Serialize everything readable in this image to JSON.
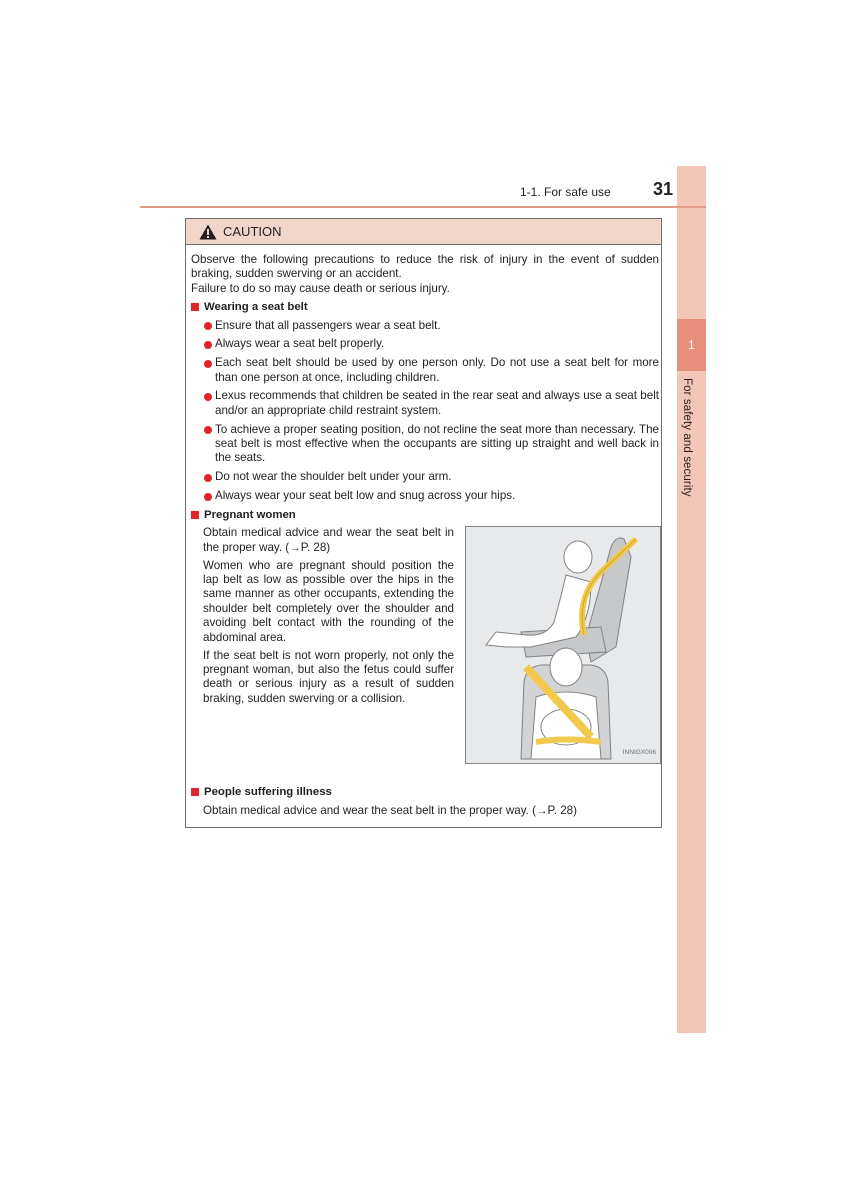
{
  "header": {
    "section": "1-1. For safe use",
    "page_number": "31"
  },
  "side_tab": {
    "chapter_number": "1",
    "chapter_title": "For safety and security"
  },
  "caution": {
    "icon": "warning-triangle-icon",
    "title": "CAUTION",
    "intro": [
      "Observe the following precautions to reduce the risk of injury in the event of sudden braking, sudden swerving or an accident.",
      "Failure to do so may cause death or serious injury."
    ],
    "sections": [
      {
        "heading": "Wearing a seat belt",
        "bullets": [
          "Ensure that all passengers wear a seat belt.",
          "Always wear a seat belt properly.",
          "Each seat belt should be used by one person only. Do not use a seat belt for more than one person at once, including children.",
          "Lexus recommends that children be seated in the rear seat and always use a seat belt and/or an appropriate child restraint system.",
          "To achieve a proper seating position, do not recline the seat more than necessary. The seat belt is most effective when the occupants are sitting up straight and well back in the seats.",
          "Do not wear the shoulder belt under your arm.",
          "Always wear your seat belt low and snug across your hips."
        ]
      },
      {
        "heading": "Pregnant women",
        "paragraphs": [
          "Obtain medical advice and wear the seat belt in the proper way. (→P. 28)",
          "Women who are pregnant should position the lap belt as low as possible over the hips in the same manner as other occupants, extending the shoulder belt completely over the shoulder and avoiding belt contact with the rounding of the abdominal area.",
          "If the seat belt is not worn properly, not only the pregnant woman, but also the fetus could suffer death or serious injury as a result of sudden braking, sudden swerving or a collision."
        ],
        "illustration": {
          "description": "Pregnant woman seated wearing seat belt, side and front views",
          "code": "INNIGX006"
        }
      },
      {
        "heading": "People suffering illness",
        "paragraphs": [
          "Obtain medical advice and wear the seat belt in the proper way. (→P. 28)"
        ]
      }
    ]
  },
  "colors": {
    "accent_red": "#e2242a",
    "tab_light": "#f4c6b8",
    "tab_dark": "#e8907c",
    "caution_header_bg": "#f2d5c9",
    "belt_yellow": "#f2c94c"
  }
}
